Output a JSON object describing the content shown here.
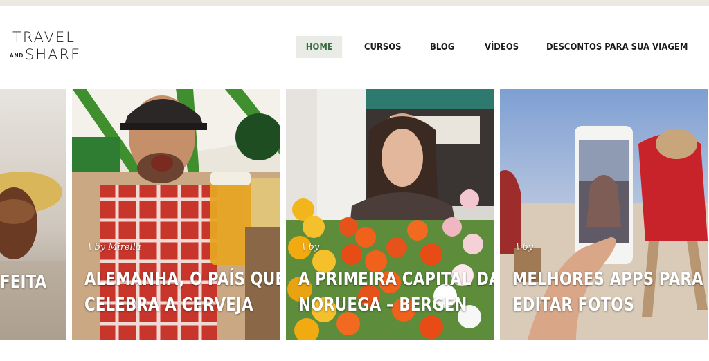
{
  "logo": {
    "line1": "TRAVEL",
    "and": "AND",
    "line2": "SHARE"
  },
  "nav": {
    "home": "HOME",
    "cursos": "CURSOS",
    "blog": "BLOG",
    "videos": "VÍDEOS",
    "descontos": "DESCONTOS PARA SUA VIAGEM"
  },
  "cards": [
    {
      "title_line1": "FEITA",
      "title_line2": ""
    },
    {
      "byline": "by Mirella",
      "title_line1": "ALEMANHA, O PAÍS QUE",
      "title_line2": "CELEBRA A CERVEJA"
    },
    {
      "byline": "by",
      "title_line1": "A PRIMEIRA CAPITAL DA",
      "title_line2": "NORUEGA – BERGEN"
    },
    {
      "byline": "by",
      "title_line1": "MELHORES APPS PARA",
      "title_line2": "EDITAR FOTOS"
    }
  ],
  "colors": {
    "accent": "#3c6b46",
    "nav_active_bg": "#e9ece6",
    "top_bar": "#ece9e3"
  }
}
